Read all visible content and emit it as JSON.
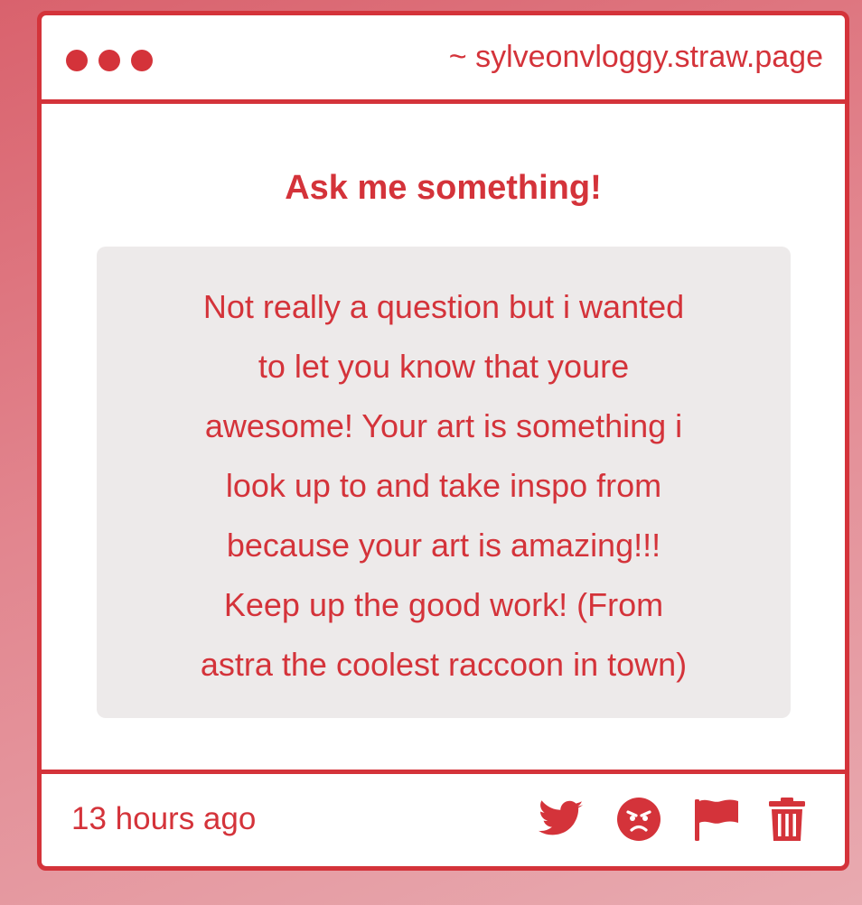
{
  "window": {
    "controls": [
      "dot",
      "dot",
      "dot"
    ],
    "url": "~ sylveonvloggy.straw.page"
  },
  "post": {
    "heading": "Ask me something!",
    "question_lines": [
      "Not really a question but i wanted",
      "to let you know that youre",
      "awesome! Your art is something i",
      "look up to and take inspo from",
      "because your art is amazing!!!",
      "Keep up the good work! (From",
      "astra the coolest raccoon in town)"
    ]
  },
  "footer": {
    "timestamp": "13 hours ago",
    "actions": [
      "twitter-icon",
      "angry-face-icon",
      "flag-icon",
      "trash-icon"
    ]
  },
  "colors": {
    "accent": "#d4333a",
    "bubble": "#edeaea",
    "background_top": "#d9626d",
    "background_bottom": "#e8aab0"
  }
}
